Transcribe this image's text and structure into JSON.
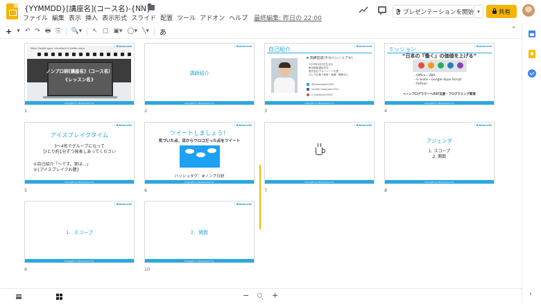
{
  "header": {
    "title": "{YYMMDD}[講座名](コース名)-{NN}",
    "menu": [
      "ファイル",
      "編集",
      "表示",
      "挿入",
      "表示形式",
      "スライド",
      "配置",
      "ツール",
      "アドオン",
      "ヘルプ"
    ],
    "last_edit": "最終編集: 昨日の 22:00",
    "present_label": "プレゼンテーションを開始",
    "share_label": "共有",
    "present_dropdown": "▾",
    "star": "☆"
  },
  "toolbar": {
    "new_slide": "+",
    "ime": "あ",
    "collapse": "⌃",
    "items": [
      "▾",
      "↶",
      "↷",
      "🖶",
      "⎘",
      "|",
      "🔍▾",
      "|",
      "↖",
      "▢",
      "▣▾",
      "◯▾",
      "╲▾",
      "|"
    ]
  },
  "slides": [
    {
      "num": "1",
      "caption": "Make Google apps, visualized in better ways",
      "title": "ノンプロ研[講座名]（コース名）",
      "subtitle": "{レッスン名}"
    },
    {
      "num": "2",
      "title": "講師紹介"
    },
    {
      "num": "3",
      "title": "自己紹介",
      "name": "高橋宣成(タカハシノリアキ)",
      "items": [
        "1976年5月5日生まれ",
        "東京都板橋区在住",
        "株式会社ブルーノート代表",
        "ひとり社長で研修・執筆・開発など"
      ],
      "social": [
        "@ntakahashi0505",
        "noriaki takahashi 923",
        "n_takahashi0505"
      ]
    },
    {
      "num": "4",
      "title": "ミッション",
      "headline": "“日本の『働く』の価値を上げる”",
      "items": [
        "Office・VBA",
        "G Suite・Google Apps Script",
        "Python"
      ],
      "footer": "⇒ノンプログラマーへのIT支援・プログラミング教育"
    },
    {
      "num": "5",
      "title": "アイスブレイクタイム",
      "lines": [
        "3〜4名でグループになって",
        "ひとり約1分ずつ発表しあってください"
      ],
      "items": [
        "①自己紹介「〜です。実は…」",
        "②{アイスブレイクお題}"
      ]
    },
    {
      "num": "6",
      "title": "ツイートしましょう！",
      "subtitle": "気づいた点、目からウロコだった点をツイート",
      "hashtag": "ハッシュタグ：#ノンプロ研"
    },
    {
      "num": "7"
    },
    {
      "num": "8",
      "title": "アジェンダ",
      "items": [
        "1. スコープ",
        "2. 関数"
      ]
    },
    {
      "num": "9",
      "title": "1．スコープ"
    },
    {
      "num": "10",
      "title": "2．関数"
    }
  ],
  "slide_brand": "✓ Blueaccent",
  "slide_footer": "Copyright (c) Blueaccent Inc.",
  "bottombar": {
    "zoom_out": "−",
    "zoom_in": "+"
  },
  "sidepanel": {
    "expand": "›"
  },
  "colors": {
    "accent": "#29a8e0",
    "brand_yellow": "#f4b400"
  }
}
